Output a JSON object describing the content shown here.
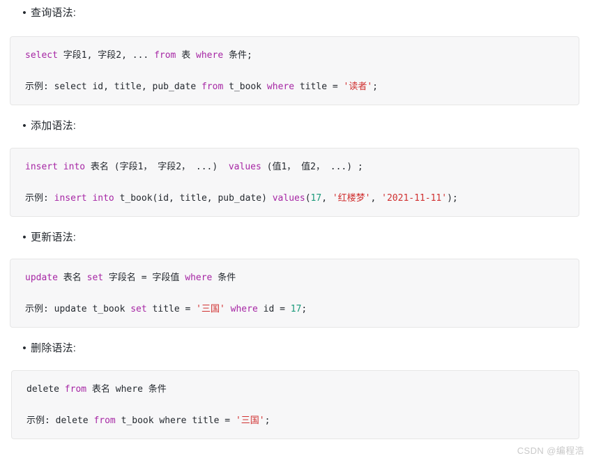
{
  "colors": {
    "keyword": "#a626a4",
    "string": "#d03030",
    "number": "#1a9a7a",
    "text": "#24292f",
    "code_bg": "#f7f7f8",
    "code_border": "#e6e6e6",
    "watermark": "#c9c9c9",
    "page_bg": "#ffffff"
  },
  "bullet_glyph": "•",
  "sections": [
    {
      "heading": "查询语法:",
      "syntax_line": {
        "tokens": [
          {
            "t": "select",
            "k": "kw"
          },
          {
            "t": " 字段1, 字段2, ... ",
            "k": "plain"
          },
          {
            "t": "from",
            "k": "kw"
          },
          {
            "t": " 表 ",
            "k": "plain"
          },
          {
            "t": "where",
            "k": "kw"
          },
          {
            "t": " 条件;",
            "k": "plain"
          }
        ],
        "plain_text": "select 字段1, 字段2, ... from 表 where 条件;"
      },
      "example_line": {
        "prefix": "示例: ",
        "tokens": [
          {
            "t": "示例: select id, title, pub_date ",
            "k": "plain"
          },
          {
            "t": "from",
            "k": "kw"
          },
          {
            "t": " t_book ",
            "k": "plain"
          },
          {
            "t": "where",
            "k": "kw"
          },
          {
            "t": " title = ",
            "k": "plain"
          },
          {
            "t": "'读者'",
            "k": "str"
          },
          {
            "t": ";",
            "k": "plain"
          }
        ],
        "plain_text": "示例: select id, title, pub_date from t_book where title = '读者';"
      }
    },
    {
      "heading": "添加语法:",
      "syntax_line": {
        "tokens": [
          {
            "t": "insert into",
            "k": "kw"
          },
          {
            "t": " 表名 (字段1， 字段2， ...)  ",
            "k": "plain"
          },
          {
            "t": "values",
            "k": "kw"
          },
          {
            "t": " (值1， 值2， ...) ;",
            "k": "plain"
          }
        ],
        "plain_text": "insert into 表名 (字段1， 字段2， ...)  values (值1， 值2， ...) ;"
      },
      "example_line": {
        "prefix": "示例: ",
        "tokens": [
          {
            "t": "示例: ",
            "k": "plain"
          },
          {
            "t": "insert into",
            "k": "kw"
          },
          {
            "t": " t_book(id, title, pub_date) ",
            "k": "plain"
          },
          {
            "t": "values",
            "k": "kw"
          },
          {
            "t": "(",
            "k": "plain"
          },
          {
            "t": "17",
            "k": "num"
          },
          {
            "t": ", ",
            "k": "plain"
          },
          {
            "t": "'红楼梦'",
            "k": "str"
          },
          {
            "t": ", ",
            "k": "plain"
          },
          {
            "t": "'2021-11-11'",
            "k": "str"
          },
          {
            "t": ");",
            "k": "plain"
          }
        ],
        "plain_text": "示例: insert into t_book(id, title, pub_date) values(17, '红楼梦', '2021-11-11');"
      }
    },
    {
      "heading": "更新语法:",
      "syntax_line": {
        "tokens": [
          {
            "t": "update",
            "k": "kw"
          },
          {
            "t": " 表名 ",
            "k": "plain"
          },
          {
            "t": "set",
            "k": "kw"
          },
          {
            "t": " 字段名 = 字段值 ",
            "k": "plain"
          },
          {
            "t": "where",
            "k": "kw"
          },
          {
            "t": " 条件",
            "k": "plain"
          }
        ],
        "plain_text": "update 表名 set 字段名 = 字段值 where 条件"
      },
      "example_line": {
        "prefix": "示例: ",
        "tokens": [
          {
            "t": "示例: update t_book ",
            "k": "plain"
          },
          {
            "t": "set",
            "k": "kw"
          },
          {
            "t": " title = ",
            "k": "plain"
          },
          {
            "t": "'三国'",
            "k": "str"
          },
          {
            "t": " ",
            "k": "plain"
          },
          {
            "t": "where",
            "k": "kw"
          },
          {
            "t": " id = ",
            "k": "plain"
          },
          {
            "t": "17",
            "k": "num"
          },
          {
            "t": ";",
            "k": "plain"
          }
        ],
        "plain_text": "示例: update t_book set title = '三国' where id = 17;"
      }
    },
    {
      "heading": "删除语法:",
      "syntax_line": {
        "tokens": [
          {
            "t": "delete ",
            "k": "plain"
          },
          {
            "t": "from",
            "k": "kw"
          },
          {
            "t": " 表名 where 条件",
            "k": "plain"
          }
        ],
        "plain_text": "delete from 表名 where 条件"
      },
      "example_line": {
        "prefix": "示例: ",
        "tokens": [
          {
            "t": "示例: delete ",
            "k": "plain"
          },
          {
            "t": "from",
            "k": "kw"
          },
          {
            "t": " t_book where title = ",
            "k": "plain"
          },
          {
            "t": "'三国'",
            "k": "str"
          },
          {
            "t": ";",
            "k": "plain"
          }
        ],
        "plain_text": "示例: delete from t_book where title = '三国';"
      }
    }
  ],
  "watermark": "CSDN @编程浩"
}
